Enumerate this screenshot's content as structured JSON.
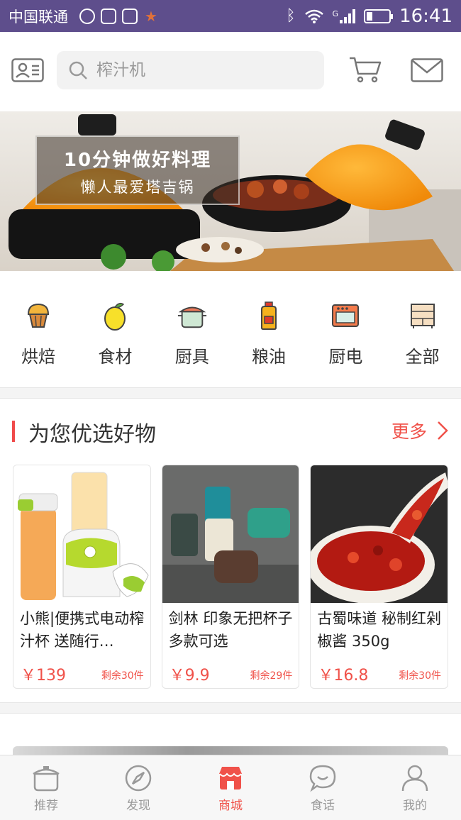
{
  "status_bar": {
    "carrier": "中国联通",
    "time": "16:41",
    "network": "G"
  },
  "header": {
    "search_placeholder": "榨汁机"
  },
  "banner": {
    "title": "10分钟做好料理",
    "subtitle": "懒人最爱塔吉锅"
  },
  "categories": [
    {
      "label": "烘焙",
      "icon": "muffin-icon"
    },
    {
      "label": "食材",
      "icon": "lemon-icon"
    },
    {
      "label": "厨具",
      "icon": "pot-icon"
    },
    {
      "label": "粮油",
      "icon": "oil-bottle-icon"
    },
    {
      "label": "厨电",
      "icon": "oven-icon"
    },
    {
      "label": "全部",
      "icon": "cabinet-icon"
    }
  ],
  "section": {
    "title": "为您优选好物",
    "more": "更多"
  },
  "products": [
    {
      "name": "小熊|便携式电动榨汁杯 送随行…",
      "price": "￥139",
      "stock": "剩余30件"
    },
    {
      "name": "剑林 印象无把杯子 多款可选",
      "price": "￥9.9",
      "stock": "剩余29件"
    },
    {
      "name": "古蜀味道 秘制红剁椒酱 350g",
      "price": "￥16.8",
      "stock": "剩余30件"
    }
  ],
  "tabbar": [
    {
      "label": "推荐",
      "icon": "pot-outline-icon",
      "active": false
    },
    {
      "label": "发现",
      "icon": "compass-icon",
      "active": false
    },
    {
      "label": "商城",
      "icon": "shop-icon",
      "active": true
    },
    {
      "label": "食话",
      "icon": "chat-bubble-icon",
      "active": false
    },
    {
      "label": "我的",
      "icon": "person-icon",
      "active": false
    }
  ],
  "colors": {
    "accent": "#f0524a",
    "status_bar": "#5e4e8c"
  }
}
